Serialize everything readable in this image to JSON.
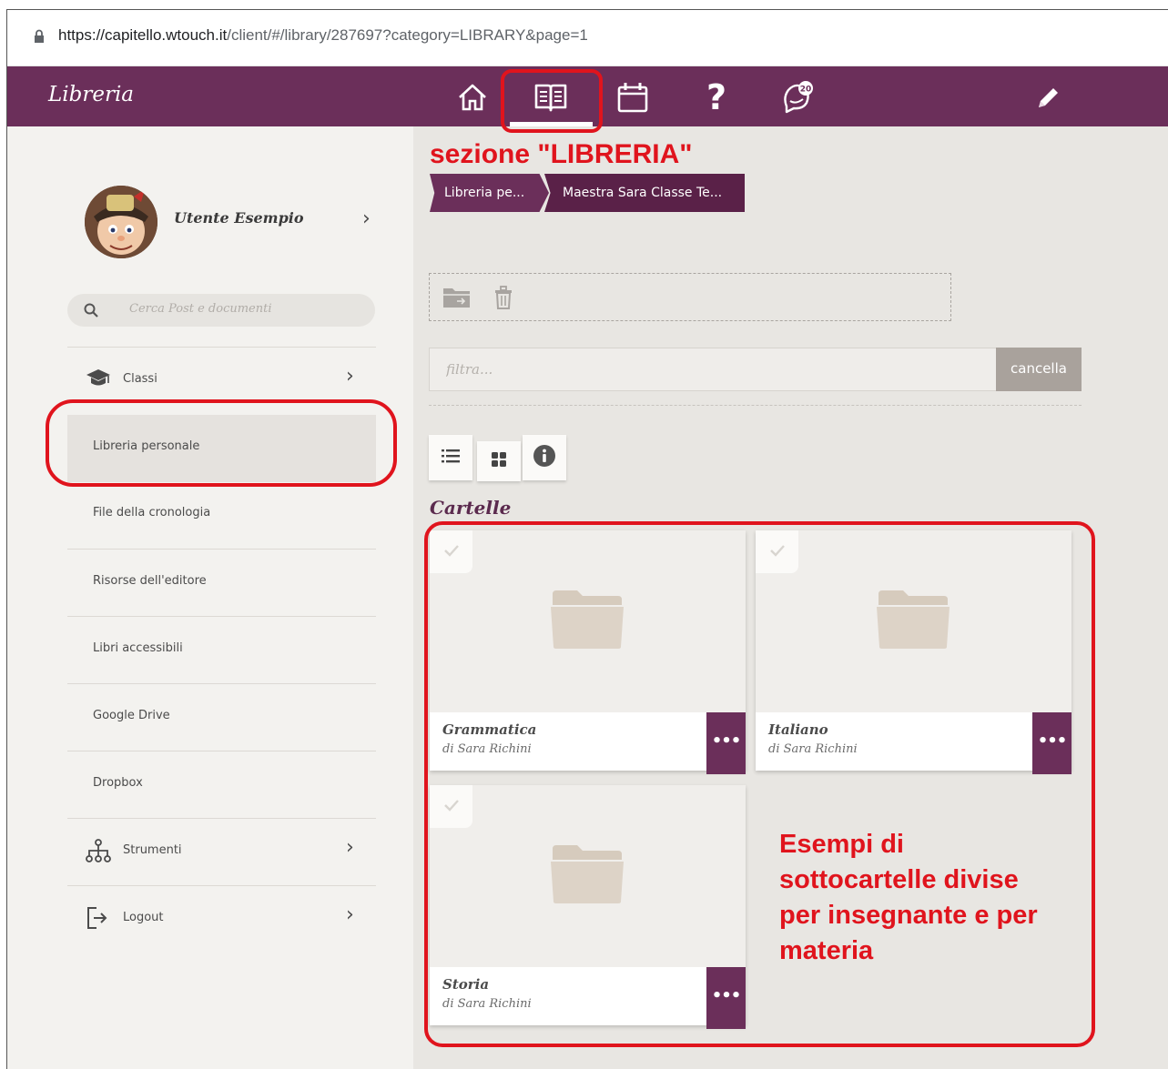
{
  "browser": {
    "url_host": "https://capitello.wtouch.it",
    "url_path": "/client/#/library/287697?category=LIBRARY&page=1"
  },
  "topbar": {
    "title": "Libreria",
    "nav": [
      {
        "name": "home-icon"
      },
      {
        "name": "library-book-icon",
        "active": true
      },
      {
        "name": "calendar-icon"
      },
      {
        "name": "help-icon",
        "glyph": "?"
      },
      {
        "name": "notifications-icon",
        "badge": "20"
      },
      {
        "name": "pencil-icon"
      }
    ],
    "colors": {
      "bar": "#6b2f5a",
      "highlight": "#e0141d"
    }
  },
  "sidebar": {
    "user_name": "Utente Esempio",
    "search_placeholder": "Cerca Post e documenti",
    "items": [
      {
        "label": "Classi",
        "icon": "graduation-cap-icon",
        "has_chevron": true
      },
      {
        "label": "Libreria personale",
        "active": true
      },
      {
        "label": "File della cronologia"
      },
      {
        "label": "Risorse dell'editore"
      },
      {
        "label": "Libri accessibili"
      },
      {
        "label": "Google Drive"
      },
      {
        "label": "Dropbox"
      },
      {
        "label": "Strumenti",
        "icon": "sitemap-icon",
        "has_chevron": true
      },
      {
        "label": "Logout",
        "icon": "logout-icon",
        "has_chevron": true
      }
    ]
  },
  "main": {
    "annotation_title": "sezione \"LIBRERIA\"",
    "breadcrumb": [
      "Libreria pe...",
      "Maestra Sara Classe Te..."
    ],
    "filter_placeholder": "filtra...",
    "cancel_label": "cancella",
    "section_title": "Cartelle",
    "folders": [
      {
        "name": "Grammatica",
        "owner": "di Sara Richini"
      },
      {
        "name": "Italiano",
        "owner": "di Sara Richini"
      },
      {
        "name": "Storia",
        "owner": "di Sara Richini"
      }
    ],
    "more_label": "•••",
    "annotation_note": "Esempi di sottocartelle divise per insegnante e per materia"
  }
}
